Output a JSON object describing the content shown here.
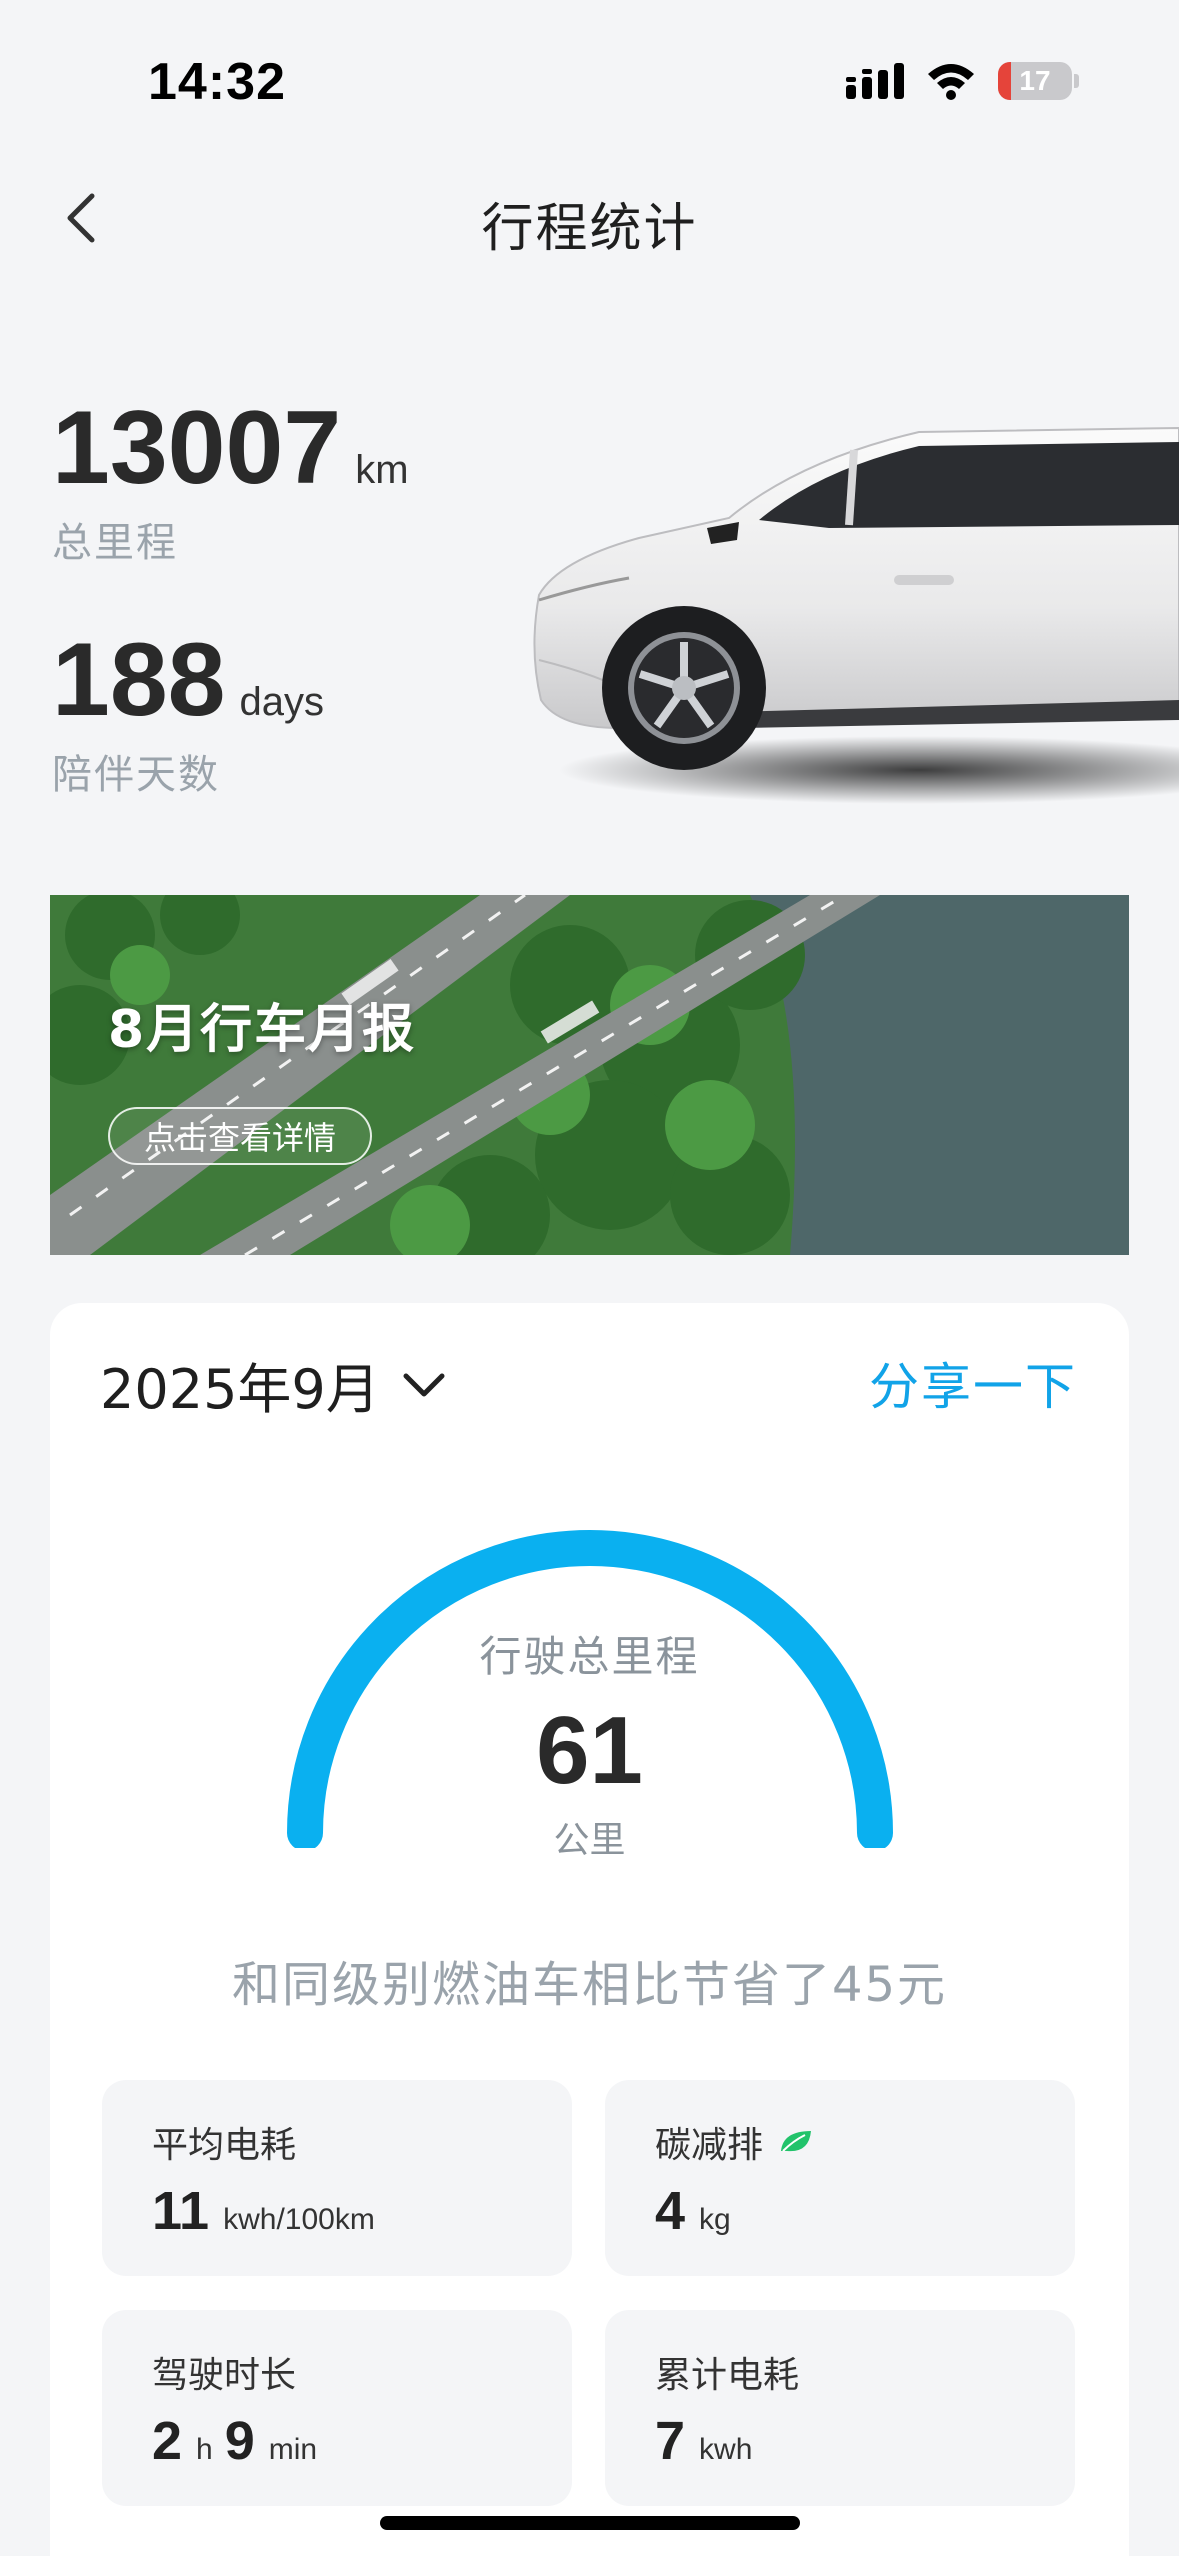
{
  "status_bar": {
    "time": "14:32",
    "battery": "17",
    "battery_level": 0.17
  },
  "nav": {
    "title": "行程统计"
  },
  "hero": {
    "total_km": {
      "value": "13007",
      "unit": "km",
      "label": "总里程"
    },
    "days": {
      "value": "188",
      "unit": "days",
      "label": "陪伴天数"
    }
  },
  "banner": {
    "title": "8月行车月报",
    "button": "点击查看详情"
  },
  "card": {
    "month": "2025年9月",
    "share": "分享一下",
    "gauge": {
      "label": "行驶总里程",
      "value": "61",
      "unit": "公里"
    },
    "saving": "和同级别燃油车相比节省了45元",
    "tiles": [
      {
        "label": "平均电耗",
        "value": "11",
        "unit": "kwh/100km"
      },
      {
        "label": "碳减排",
        "value": "4",
        "unit": "kg",
        "icon": "leaf-icon"
      },
      {
        "label": "驾驶时长",
        "hours": "2",
        "hours_unit": "h",
        "minutes": "9",
        "minutes_unit": "min"
      },
      {
        "label": "累计电耗",
        "value": "7",
        "unit": "kwh"
      }
    ]
  },
  "colors": {
    "accent": "#11a3e8",
    "gauge": "#0ab0f0",
    "leaf": "#22c36b"
  }
}
